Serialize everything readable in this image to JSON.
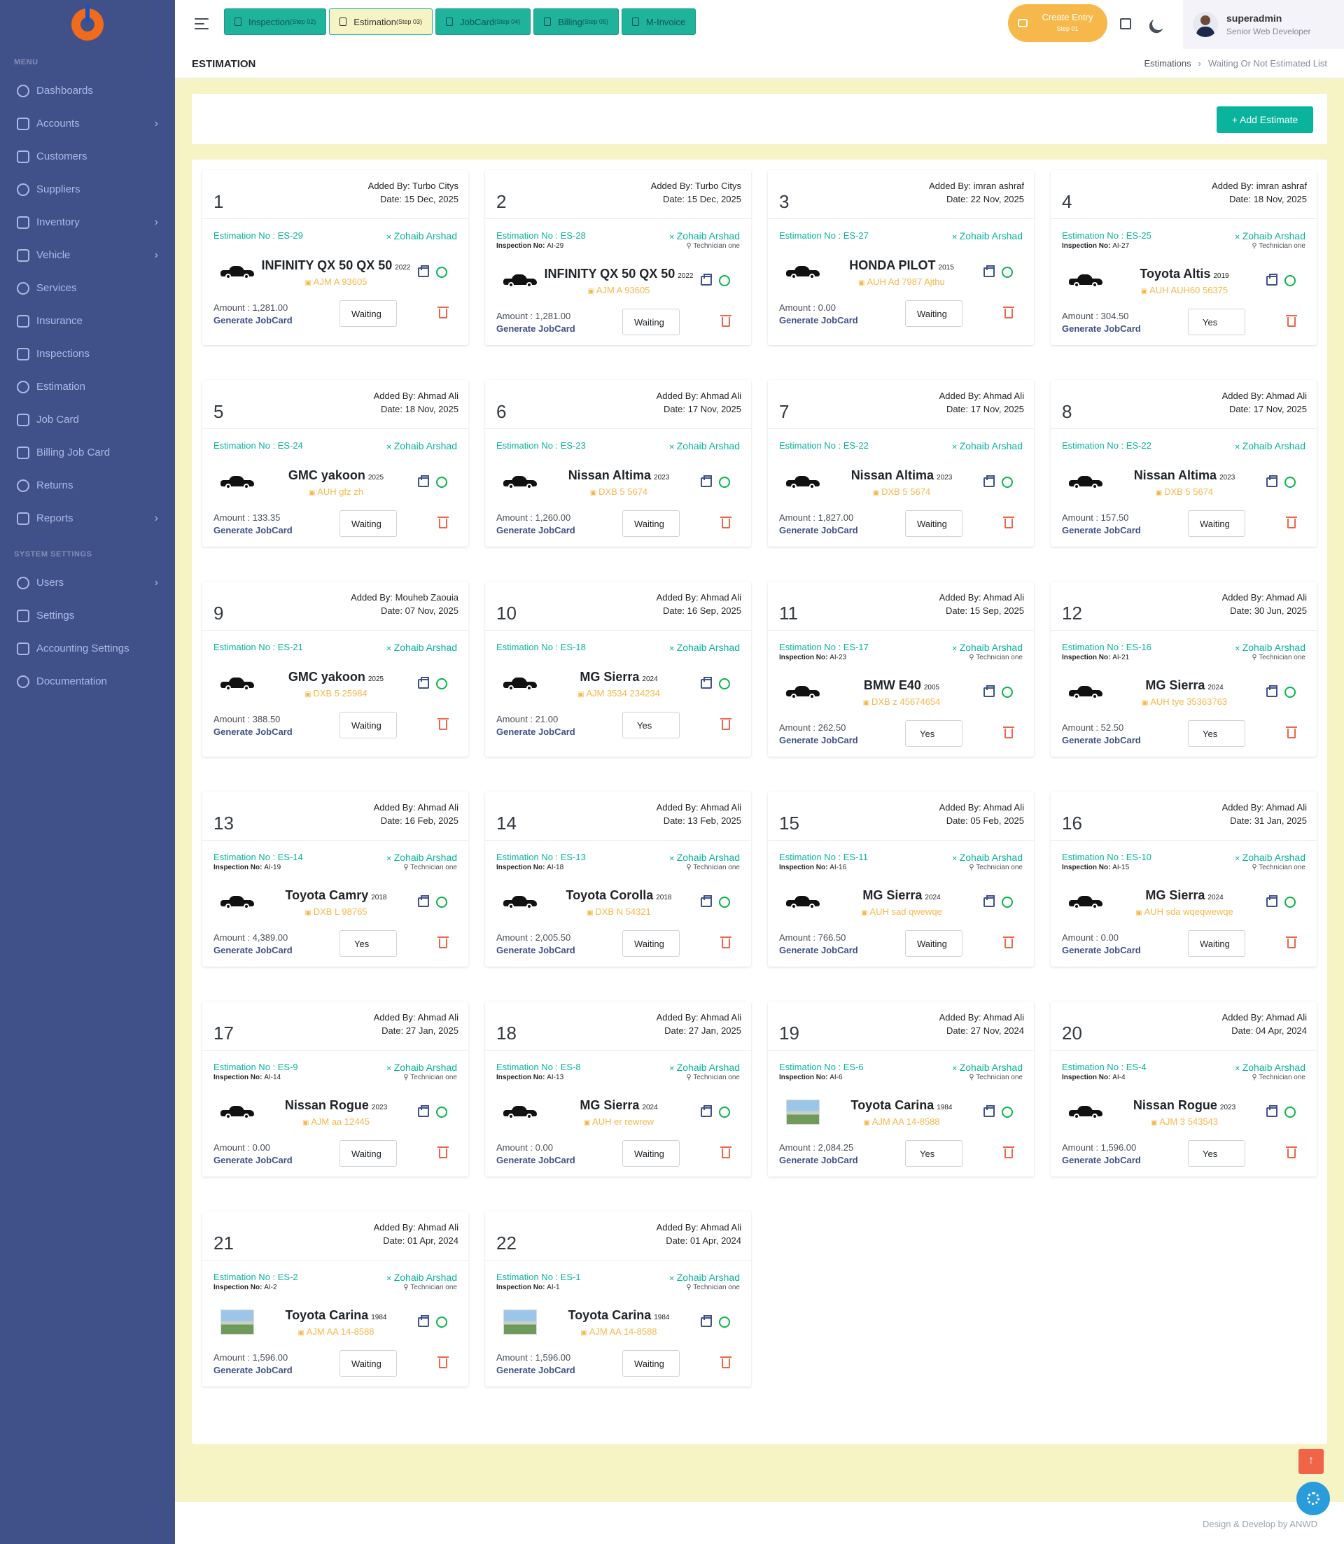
{
  "menu": {
    "title": "MENU",
    "items": [
      {
        "label": "Dashboards",
        "chevron": false
      },
      {
        "label": "Accounts",
        "chevron": true
      },
      {
        "label": "Customers",
        "chevron": false
      },
      {
        "label": "Suppliers",
        "chevron": false
      },
      {
        "label": "Inventory",
        "chevron": true
      },
      {
        "label": "Vehicle",
        "chevron": true
      },
      {
        "label": "Services",
        "chevron": false
      },
      {
        "label": "Insurance",
        "chevron": false
      },
      {
        "label": "Inspections",
        "chevron": false
      },
      {
        "label": "Estimation",
        "chevron": false
      },
      {
        "label": "Job Card",
        "chevron": false
      },
      {
        "label": "Billing Job Card",
        "chevron": false
      },
      {
        "label": "Returns",
        "chevron": false
      },
      {
        "label": "Reports",
        "chevron": true
      }
    ],
    "system_title": "SYSTEM SETTINGS",
    "system_items": [
      {
        "label": "Users",
        "chevron": true
      },
      {
        "label": "Settings",
        "chevron": false
      },
      {
        "label": "Accounting Settings",
        "chevron": false
      },
      {
        "label": "Documentation",
        "chevron": false
      }
    ]
  },
  "topbar": {
    "steps": [
      {
        "label": "Inspection",
        "sub": "(Step 02)",
        "active": false
      },
      {
        "label": "Estimation",
        "sub": "(Step 03)",
        "active": true
      },
      {
        "label": "JobCard",
        "sub": "(Step 04)",
        "active": false
      },
      {
        "label": "Billing",
        "sub": "(Step 05)",
        "active": false
      },
      {
        "label": "M-Invoice",
        "sub": "",
        "active": false
      }
    ],
    "create_entry": {
      "label": "Create Entry",
      "sub": "Step 01"
    },
    "user": {
      "name": "superadmin",
      "role": "Senior Web Developer"
    }
  },
  "page": {
    "title": "ESTIMATION",
    "breadcrumb": [
      "Estimations",
      "Waiting Or Not Estimated List"
    ],
    "add_button": "+ Add Estimate",
    "generate_label": "Generate JobCard"
  },
  "estimates": [
    {
      "idx": "1",
      "added_by": "Added By: Turbo Citys",
      "date": "Date: 15 Dec, 2025",
      "est_no": "Estimation No : ES-29",
      "insp_no": "",
      "tech": "Zohaib Arshad",
      "tech_role": "",
      "vehicle": "INFINITY QX 50 QX 50",
      "year": "2022",
      "plate": "AJM A 93605",
      "photo": false,
      "amount": "Amount : 1,281.00",
      "status": "Waiting"
    },
    {
      "idx": "2",
      "added_by": "Added By: Turbo Citys",
      "date": "Date: 15 Dec, 2025",
      "est_no": "Estimation No : ES-28",
      "insp_no": "AI-29",
      "tech": "Zohaib Arshad",
      "tech_role": "Technician one",
      "vehicle": "INFINITY QX 50 QX 50",
      "year": "2022",
      "plate": "AJM A 93605",
      "photo": false,
      "amount": "Amount : 1,281.00",
      "status": "Waiting"
    },
    {
      "idx": "3",
      "added_by": "Added By: imran ashraf",
      "date": "Date: 22 Nov, 2025",
      "est_no": "Estimation No : ES-27",
      "insp_no": "",
      "tech": "Zohaib Arshad",
      "tech_role": "",
      "vehicle": "HONDA PILOT",
      "year": "2015",
      "plate": "AUH Ad 7987 Ajthu",
      "photo": false,
      "amount": "Amount : 0.00",
      "status": "Waiting"
    },
    {
      "idx": "4",
      "added_by": "Added By: imran ashraf",
      "date": "Date: 18 Nov, 2025",
      "est_no": "Estimation No : ES-25",
      "insp_no": "AI-27",
      "tech": "Zohaib Arshad",
      "tech_role": "Technician one",
      "vehicle": "Toyota Altis",
      "year": "2019",
      "plate": "AUH AUH60 56375",
      "photo": false,
      "amount": "Amount : 304.50",
      "status": "Yes"
    },
    {
      "idx": "5",
      "added_by": "Added By: Ahmad Ali",
      "date": "Date: 18 Nov, 2025",
      "est_no": "Estimation No : ES-24",
      "insp_no": "",
      "tech": "Zohaib Arshad",
      "tech_role": "",
      "vehicle": "GMC yakoon",
      "year": "2025",
      "plate": "AUH gfz zh",
      "photo": false,
      "amount": "Amount : 133.35",
      "status": "Waiting"
    },
    {
      "idx": "6",
      "added_by": "Added By: Ahmad Ali",
      "date": "Date: 17 Nov, 2025",
      "est_no": "Estimation No : ES-23",
      "insp_no": "",
      "tech": "Zohaib Arshad",
      "tech_role": "",
      "vehicle": "Nissan Altima",
      "year": "2023",
      "plate": "DXB 5 5674",
      "photo": false,
      "amount": "Amount : 1,260.00",
      "status": "Waiting"
    },
    {
      "idx": "7",
      "added_by": "Added By: Ahmad Ali",
      "date": "Date: 17 Nov, 2025",
      "est_no": "Estimation No : ES-22",
      "insp_no": "",
      "tech": "Zohaib Arshad",
      "tech_role": "",
      "vehicle": "Nissan Altima",
      "year": "2023",
      "plate": "DXB 5 5674",
      "photo": false,
      "amount": "Amount : 1,827.00",
      "status": "Waiting"
    },
    {
      "idx": "8",
      "added_by": "Added By: Ahmad Ali",
      "date": "Date: 17 Nov, 2025",
      "est_no": "Estimation No : ES-22",
      "insp_no": "",
      "tech": "Zohaib Arshad",
      "tech_role": "",
      "vehicle": "Nissan Altima",
      "year": "2023",
      "plate": "DXB 5 5674",
      "photo": false,
      "amount": "Amount : 157.50",
      "status": "Waiting"
    },
    {
      "idx": "9",
      "added_by": "Added By: Mouheb Zaouia",
      "date": "Date: 07 Nov, 2025",
      "est_no": "Estimation No : ES-21",
      "insp_no": "",
      "tech": "Zohaib Arshad",
      "tech_role": "",
      "vehicle": "GMC yakoon",
      "year": "2025",
      "plate": "DXB 5 25984",
      "photo": false,
      "amount": "Amount : 388.50",
      "status": "Waiting"
    },
    {
      "idx": "10",
      "added_by": "Added By: Ahmad Ali",
      "date": "Date: 16 Sep, 2025",
      "est_no": "Estimation No : ES-18",
      "insp_no": "",
      "tech": "Zohaib Arshad",
      "tech_role": "",
      "vehicle": "MG Sierra",
      "year": "2024",
      "plate": "AJM 3534 234234",
      "photo": false,
      "amount": "Amount : 21.00",
      "status": "Yes"
    },
    {
      "idx": "11",
      "added_by": "Added By: Ahmad Ali",
      "date": "Date: 15 Sep, 2025",
      "est_no": "Estimation No : ES-17",
      "insp_no": "AI-23",
      "tech": "Zohaib Arshad",
      "tech_role": "Technician one",
      "vehicle": "BMW E40",
      "year": "2005",
      "plate": "DXB z 45674654",
      "photo": false,
      "amount": "Amount : 262.50",
      "status": "Yes"
    },
    {
      "idx": "12",
      "added_by": "Added By: Ahmad Ali",
      "date": "Date: 30 Jun, 2025",
      "est_no": "Estimation No : ES-16",
      "insp_no": "AI-21",
      "tech": "Zohaib Arshad",
      "tech_role": "Technician one",
      "vehicle": "MG Sierra",
      "year": "2024",
      "plate": "AUH tye 35363763",
      "photo": false,
      "amount": "Amount : 52.50",
      "status": "Yes"
    },
    {
      "idx": "13",
      "added_by": "Added By: Ahmad Ali",
      "date": "Date: 16 Feb, 2025",
      "est_no": "Estimation No : ES-14",
      "insp_no": "AI-19",
      "tech": "Zohaib Arshad",
      "tech_role": "Technician one",
      "vehicle": "Toyota Camry",
      "year": "2018",
      "plate": "DXB L 98765",
      "photo": false,
      "amount": "Amount : 4,389.00",
      "status": "Yes"
    },
    {
      "idx": "14",
      "added_by": "Added By: Ahmad Ali",
      "date": "Date: 13 Feb, 2025",
      "est_no": "Estimation No : ES-13",
      "insp_no": "AI-18",
      "tech": "Zohaib Arshad",
      "tech_role": "Technician one",
      "vehicle": "Toyota Corolla",
      "year": "2018",
      "plate": "DXB N 54321",
      "photo": false,
      "amount": "Amount : 2,005.50",
      "status": "Waiting"
    },
    {
      "idx": "15",
      "added_by": "Added By: Ahmad Ali",
      "date": "Date: 05 Feb, 2025",
      "est_no": "Estimation No : ES-11",
      "insp_no": "AI-16",
      "tech": "Zohaib Arshad",
      "tech_role": "Technician one",
      "vehicle": "MG Sierra",
      "year": "2024",
      "plate": "AUH sad qwewqe",
      "photo": false,
      "amount": "Amount : 766.50",
      "status": "Waiting"
    },
    {
      "idx": "16",
      "added_by": "Added By: Ahmad Ali",
      "date": "Date: 31 Jan, 2025",
      "est_no": "Estimation No : ES-10",
      "insp_no": "AI-15",
      "tech": "Zohaib Arshad",
      "tech_role": "Technician one",
      "vehicle": "MG Sierra",
      "year": "2024",
      "plate": "AUH sda wqeqwewqe",
      "photo": false,
      "amount": "Amount : 0.00",
      "status": "Waiting"
    },
    {
      "idx": "17",
      "added_by": "Added By: Ahmad Ali",
      "date": "Date: 27 Jan, 2025",
      "est_no": "Estimation No : ES-9",
      "insp_no": "AI-14",
      "tech": "Zohaib Arshad",
      "tech_role": "Technician one",
      "vehicle": "Nissan Rogue",
      "year": "2023",
      "plate": "AJM aa 12445",
      "photo": false,
      "amount": "Amount : 0.00",
      "status": "Waiting"
    },
    {
      "idx": "18",
      "added_by": "Added By: Ahmad Ali",
      "date": "Date: 27 Jan, 2025",
      "est_no": "Estimation No : ES-8",
      "insp_no": "AI-13",
      "tech": "Zohaib Arshad",
      "tech_role": "Technician one",
      "vehicle": "MG Sierra",
      "year": "2024",
      "plate": "AUH er rewrew",
      "photo": false,
      "amount": "Amount : 0.00",
      "status": "Waiting"
    },
    {
      "idx": "19",
      "added_by": "Added By: Ahmad Ali",
      "date": "Date: 27 Nov, 2024",
      "est_no": "Estimation No : ES-6",
      "insp_no": "AI-6",
      "tech": "Zohaib Arshad",
      "tech_role": "Technician one",
      "vehicle": "Toyota Carina",
      "year": "1984",
      "plate": "AJM AA 14-8588",
      "photo": true,
      "amount": "Amount : 2,084.25",
      "status": "Yes"
    },
    {
      "idx": "20",
      "added_by": "Added By: Ahmad Ali",
      "date": "Date: 04 Apr, 2024",
      "est_no": "Estimation No : ES-4",
      "insp_no": "AI-4",
      "tech": "Zohaib Arshad",
      "tech_role": "Technician one",
      "vehicle": "Nissan Rogue",
      "year": "2023",
      "plate": "AJM 3 543543",
      "photo": false,
      "amount": "Amount : 1,596.00",
      "status": "Yes"
    },
    {
      "idx": "21",
      "added_by": "Added By: Ahmad Ali",
      "date": "Date: 01 Apr, 2024",
      "est_no": "Estimation No : ES-2",
      "insp_no": "AI-2",
      "tech": "Zohaib Arshad",
      "tech_role": "Technician one",
      "vehicle": "Toyota Carina",
      "year": "1984",
      "plate": "AJM AA 14-8588",
      "photo": true,
      "amount": "Amount : 1,596.00",
      "status": "Waiting"
    },
    {
      "idx": "22",
      "added_by": "Added By: Ahmad Ali",
      "date": "Date: 01 Apr, 2024",
      "est_no": "Estimation No : ES-1",
      "insp_no": "AI-1",
      "tech": "Zohaib Arshad",
      "tech_role": "Technician one",
      "vehicle": "Toyota Carina",
      "year": "1984",
      "plate": "AJM AA 14-8588",
      "photo": true,
      "amount": "Amount : 1,596.00",
      "status": "Waiting"
    }
  ],
  "footer": {
    "text": "Design & Develop by ANWD"
  },
  "colors": {
    "sidebar": "#405189",
    "accent": "#0ab39c",
    "warning": "#f7b84b",
    "danger": "#f06548",
    "page_bg": "#f6f3c4"
  }
}
